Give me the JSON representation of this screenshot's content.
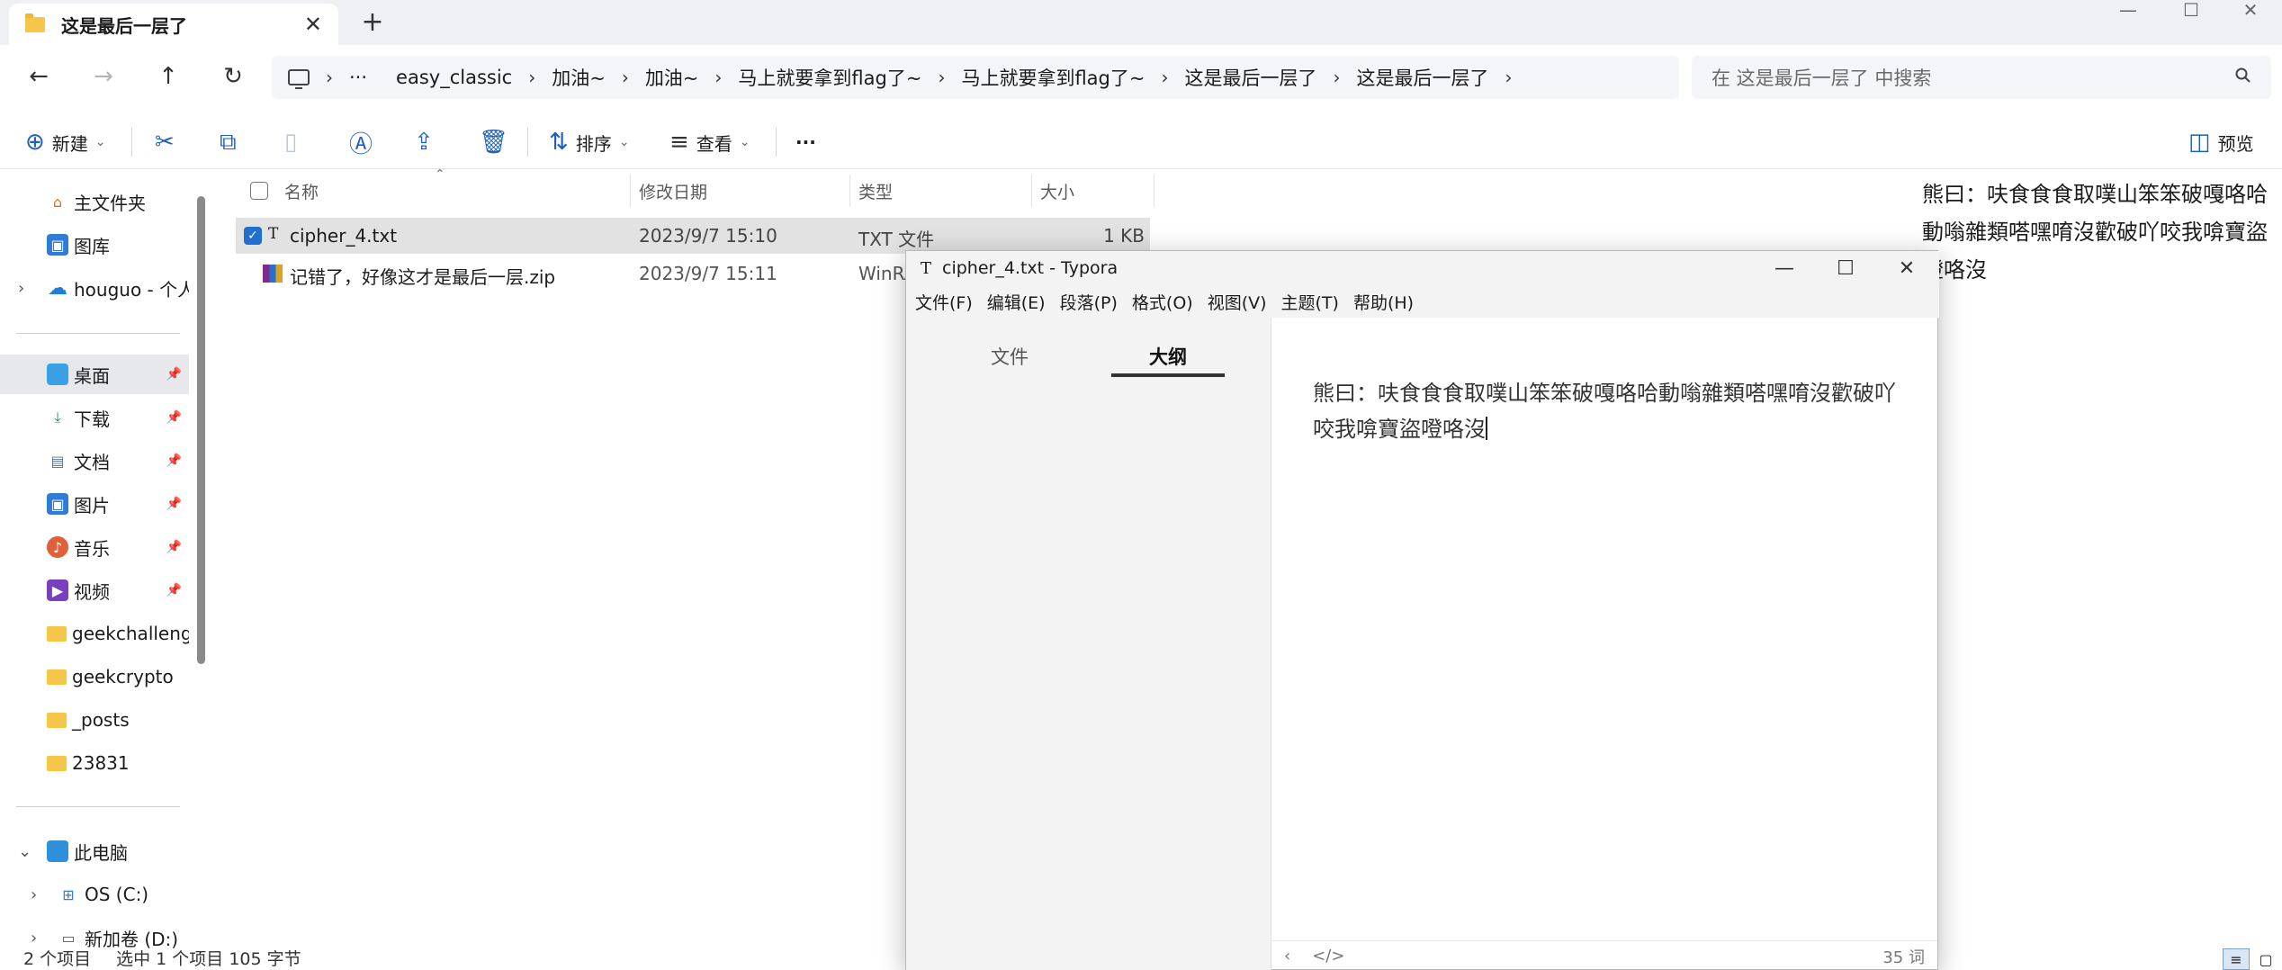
{
  "explorer": {
    "tab_title": "这是最后一层了",
    "close_glyph": "✕",
    "newtab_glyph": "+",
    "window_buttons": [
      "—",
      "☐",
      "✕"
    ],
    "nav": {
      "back": "←",
      "forward": "→",
      "up": "↑",
      "refresh": "↻"
    },
    "address": {
      "overflow": "···",
      "crumbs": [
        "easy_classic",
        "加油~",
        "加油~",
        "马上就要拿到flag了~",
        "马上就要拿到flag了~",
        "这是最后一层了",
        "这是最后一层了"
      ],
      "sep": "›"
    },
    "search_placeholder": "在 这是最后一层了 中搜索",
    "toolbar": {
      "new": "新建",
      "sort": "排序",
      "view": "查看",
      "more": "···",
      "preview": "预览"
    },
    "sidebar": {
      "home": "主文件夹",
      "gallery": "图库",
      "cloud": "houguo - 个人",
      "pinned": [
        "桌面",
        "下载",
        "文档",
        "图片",
        "音乐",
        "视频"
      ],
      "folders": [
        "geekchallenge",
        "geekcrypto",
        "_posts",
        "23831"
      ],
      "this_pc": "此电脑",
      "drives": [
        "OS (C:)",
        "新加卷 (D:)"
      ]
    },
    "columns": {
      "name": "名称",
      "date": "修改日期",
      "type": "类型",
      "size": "大小"
    },
    "files": [
      {
        "name": "cipher_4.txt",
        "date": "2023/9/7 15:10",
        "type": "TXT 文件",
        "size": "1 KB"
      },
      {
        "name": "记错了，好像这才是最后一层.zip",
        "date": "2023/9/7 15:11",
        "type": "WinRA",
        "size": ""
      }
    ],
    "status": {
      "count": "2 个项目",
      "selected": "选中 1 个项目  105 字节"
    },
    "preview_text": "熊曰：呋食食食取噗山笨笨破嘎咯哈動嗡雜類嗒嘿唷沒歡破吖咬我啽寶盜噔咯沒"
  },
  "typora": {
    "title": "cipher_4.txt - Typora",
    "title_icon": "T",
    "menu": [
      "文件(F)",
      "编辑(E)",
      "段落(P)",
      "格式(O)",
      "视图(V)",
      "主题(T)",
      "帮助(H)"
    ],
    "tabs": {
      "files": "文件",
      "outline": "大纲"
    },
    "content": "熊曰：呋食食食取噗山笨笨破嘎咯哈動嗡雜類嗒嘿唷沒歡破吖咬我啽寶盜噔咯沒",
    "word_count": "35 词",
    "footer_left": "‹",
    "footer_code": "</>"
  }
}
